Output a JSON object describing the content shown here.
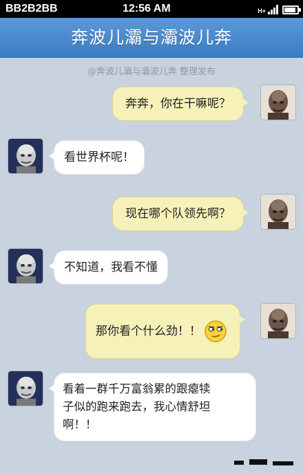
{
  "status_bar": {
    "carrier": "BB2B2BB",
    "time": "12:56 AM",
    "network": "H+"
  },
  "title": "奔波儿灞与灞波儿奔",
  "watermark": "@奔波儿灞与灞波儿奔 整理发布",
  "messages": [
    {
      "side": "right",
      "text": "奔奔，你在干嘛呢？"
    },
    {
      "side": "left",
      "text": "看世界杯呢！"
    },
    {
      "side": "right",
      "text": "现在哪个队领先啊？"
    },
    {
      "side": "left",
      "text": "不知道，我看不懂"
    },
    {
      "side": "right",
      "text": "那你看个什么劲！！",
      "emoji": "smirk-smiley"
    },
    {
      "side": "left",
      "lines": [
        "看着一群千万富翁累的跟瘪犊",
        "子似的跑来跑去，我心情舒坦",
        "啊！！"
      ]
    }
  ],
  "colors": {
    "background": "#c9d2df",
    "title_bar": "#4a8bcf",
    "right_bubble": "#f6f1b8",
    "left_bubble": "#ffffff"
  }
}
